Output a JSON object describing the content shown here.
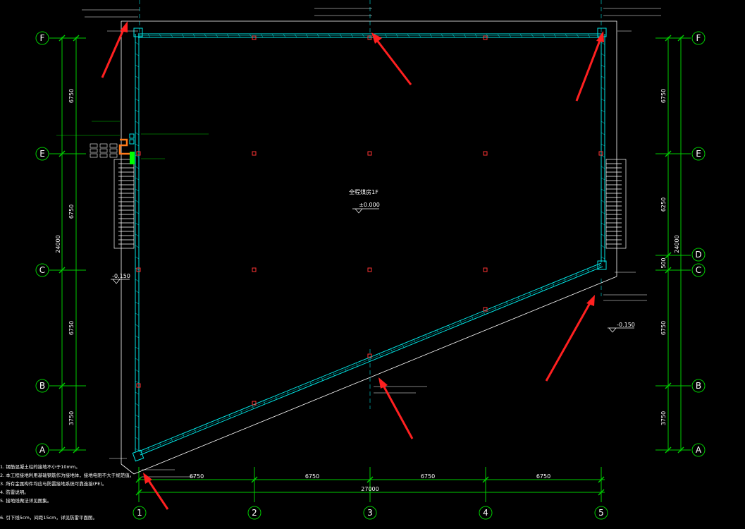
{
  "drawing": {
    "room_label": "全程煤房1F",
    "floor_elevation": "±0.000",
    "outside_elevation_left": "-0.150",
    "outside_elevation_right": "-0.150"
  },
  "row_axes": [
    "F",
    "E",
    "D",
    "C",
    "B",
    "A"
  ],
  "col_axes": [
    "1",
    "2",
    "3",
    "4",
    "5"
  ],
  "dims_left": {
    "segments": [
      "6750",
      "6750",
      "6750",
      "3750"
    ],
    "total": "24000"
  },
  "dims_right": {
    "segments": [
      "6750",
      "6250",
      "500",
      "6750",
      "3750"
    ],
    "total": "24000"
  },
  "dims_bottom": {
    "segments": [
      "6750",
      "6750",
      "6750",
      "6750"
    ],
    "total": "27000"
  },
  "notes": [
    "1. 钢筋混凝土柱的接地不小于10mm。",
    "2. 本工程接地利用基础钢筋作为接地体，接地电阻不大于规范值。",
    "3. 所有金属构件均应与防雷接地系统可靠连接(PE)。",
    "4. 防雷说明。",
    "5. 接地线做法详见图集。",
    "6. 引下线5cm，间距15cm，详见防雷平面图。"
  ],
  "colors": {
    "axis": "#00cc00",
    "wall": "#00e5e5",
    "wall_outer": "#ffffff",
    "column": "#ff3333",
    "arrow": "#ff2020",
    "box": "#ff7a1a",
    "marker": "#00ff00"
  },
  "icons": {
    "arrow": "red-pointer-arrow-icon",
    "axis_bubble": "axis-bubble-icon"
  }
}
